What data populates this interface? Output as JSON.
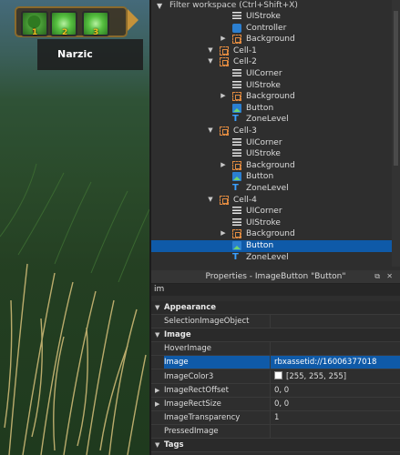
{
  "game": {
    "hotbar": {
      "slots": [
        {
          "number": "1",
          "icon": "tree-icon"
        },
        {
          "number": "2",
          "icon": "glow-icon"
        },
        {
          "number": "3",
          "icon": "glow-icon"
        }
      ]
    },
    "tooltip": "Narzic"
  },
  "explorer": {
    "filter_placeholder": "Filter workspace (Ctrl+Shift+X)",
    "rows": [
      {
        "label": "UIStroke",
        "icon": "uistroke-icon",
        "expand": false
      },
      {
        "label": "Controller",
        "icon": "script-icon",
        "expand": false
      },
      {
        "label": "Background",
        "icon": "frame-icon",
        "expand": true
      },
      {
        "label": "Cell-1",
        "icon": "frame-icon",
        "expand": true
      },
      {
        "label": "Cell-2",
        "icon": "frame-icon",
        "expand": true
      },
      {
        "label": "UICorner",
        "icon": "uicorner-icon",
        "expand": false
      },
      {
        "label": "UIStroke",
        "icon": "uistroke-icon",
        "expand": false
      },
      {
        "label": "Background",
        "icon": "frame-icon",
        "expand": true
      },
      {
        "label": "Button",
        "icon": "imagebutton-icon",
        "expand": false
      },
      {
        "label": "ZoneLevel",
        "icon": "textlabel-icon",
        "expand": false
      },
      {
        "label": "Cell-3",
        "icon": "frame-icon",
        "expand": true
      },
      {
        "label": "UICorner",
        "icon": "uicorner-icon",
        "expand": false
      },
      {
        "label": "UIStroke",
        "icon": "uistroke-icon",
        "expand": false
      },
      {
        "label": "Background",
        "icon": "frame-icon",
        "expand": true
      },
      {
        "label": "Button",
        "icon": "imagebutton-icon",
        "expand": false
      },
      {
        "label": "ZoneLevel",
        "icon": "textlabel-icon",
        "expand": false
      },
      {
        "label": "Cell-4",
        "icon": "frame-icon",
        "expand": true
      },
      {
        "label": "UICorner",
        "icon": "uicorner-icon",
        "expand": false
      },
      {
        "label": "UIStroke",
        "icon": "uistroke-icon",
        "expand": false
      },
      {
        "label": "Background",
        "icon": "frame-icon",
        "expand": true
      },
      {
        "label": "Button",
        "icon": "imagebutton-icon",
        "expand": false,
        "selected": true
      },
      {
        "label": "ZoneLevel",
        "icon": "textlabel-icon",
        "expand": false
      }
    ]
  },
  "properties": {
    "title": "Properties - ImageButton \"Button\"",
    "search_value": "im",
    "rows": [
      {
        "name": "Appearance",
        "category": true
      },
      {
        "name": "SelectionImageObject",
        "value": ""
      },
      {
        "name": "Image",
        "category": true
      },
      {
        "name": "HoverImage",
        "value": ""
      },
      {
        "name": "Image",
        "value": "rbxassetid://16006377018",
        "selected": true
      },
      {
        "name": "ImageColor3",
        "value": "[255, 255, 255]",
        "swatch": "#ffffff"
      },
      {
        "name": "ImageRectOffset",
        "value": "0, 0",
        "expand": true
      },
      {
        "name": "ImageRectSize",
        "value": "0, 0",
        "expand": true
      },
      {
        "name": "ImageTransparency",
        "value": "1"
      },
      {
        "name": "PressedImage",
        "value": ""
      },
      {
        "name": "Tags",
        "category": true
      }
    ]
  },
  "colors": {
    "selection": "#0f5aa8",
    "frame_icon": "#e08a40",
    "hotbar_border": "#8a6a2c"
  }
}
